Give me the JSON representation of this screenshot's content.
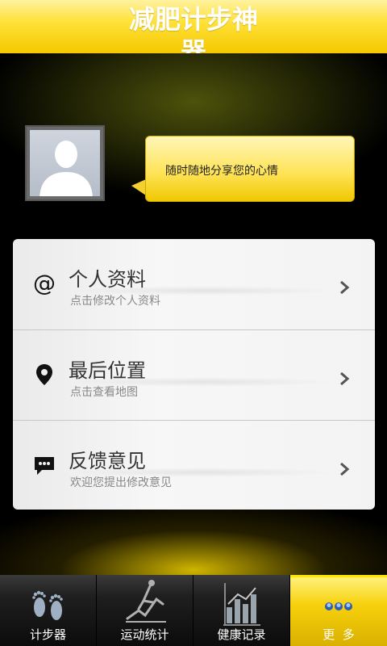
{
  "header": {
    "title": "减肥计步神器"
  },
  "profile": {
    "status_placeholder": "随时随地分享您的心情"
  },
  "menu": {
    "items": [
      {
        "icon": "at-icon",
        "label": "个人资料",
        "sub": "点击修改个人资料"
      },
      {
        "icon": "location-pin-icon",
        "label": "最后位置",
        "sub": "点击查看地图"
      },
      {
        "icon": "chat-bubble-icon",
        "label": "反馈意见",
        "sub": "欢迎您提出修改意见"
      }
    ]
  },
  "tabs": [
    {
      "icon": "footprints-icon",
      "label": "计步器"
    },
    {
      "icon": "runner-stats-icon",
      "label": "运动统计"
    },
    {
      "icon": "bar-chart-icon",
      "label": "健康记录"
    },
    {
      "icon": "more-dots-icon",
      "label": "更  多",
      "active": true
    }
  ],
  "colors": {
    "accent": "#f5c800",
    "card_bg": "#f3f3f3",
    "tab_bg": "#1f1f1f"
  }
}
